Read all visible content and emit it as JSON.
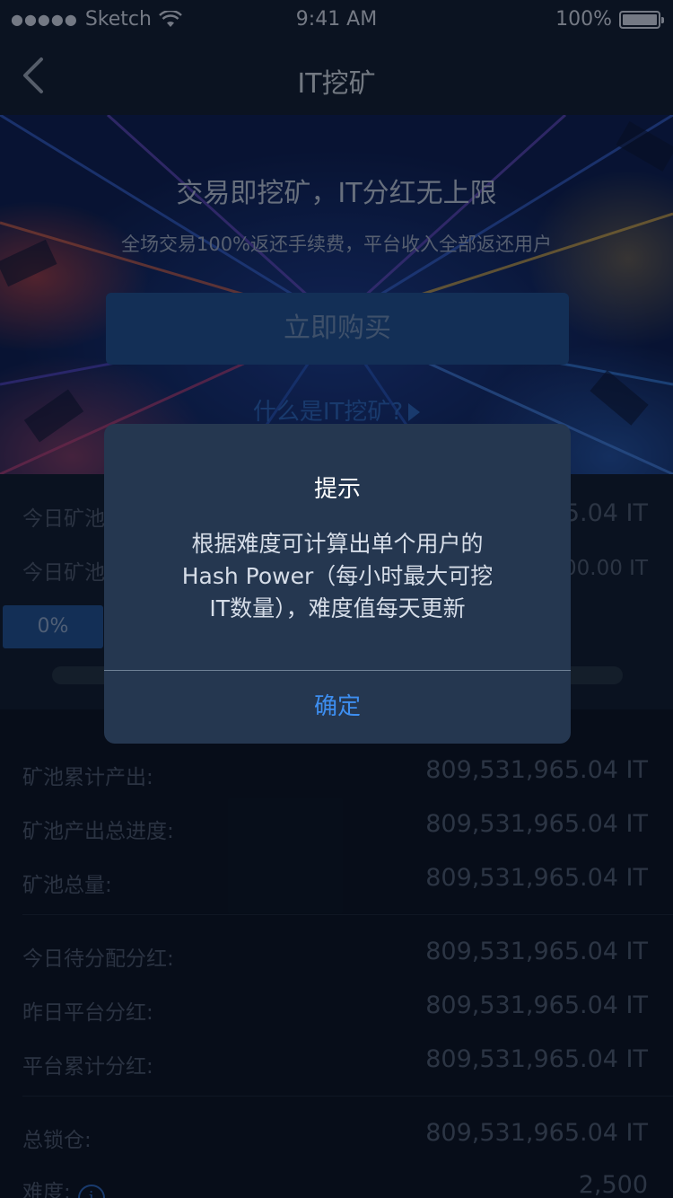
{
  "status_bar": {
    "carrier": "Sketch",
    "time": "9:41 AM",
    "battery": "100%"
  },
  "nav": {
    "title": "IT挖矿",
    "back_icon": "chevron-left-icon"
  },
  "hero": {
    "title": "交易即挖矿，IT分红无上限",
    "subtitle": "全场交易100%返还手续费，平台收入全部返还用户",
    "buy_label": "立即购买",
    "what_link": "什么是IT挖矿?"
  },
  "today": {
    "rows": [
      {
        "label": "今日矿池",
        "value": "5.04 IT"
      },
      {
        "label": "今日矿池",
        "value": "00.00 IT"
      }
    ],
    "progress_label": "0%",
    "progress_value": 0
  },
  "stats": {
    "groups": [
      [
        {
          "label": "矿池累计产出:",
          "value": "809,531,965.04 IT"
        },
        {
          "label": "矿池产出总进度:",
          "value": "809,531,965.04 IT"
        },
        {
          "label": "矿池总量:",
          "value": "809,531,965.04 IT"
        }
      ],
      [
        {
          "label": "今日待分配分红:",
          "value": "809,531,965.04 IT"
        },
        {
          "label": "昨日平台分红:",
          "value": "809,531,965.04 IT"
        },
        {
          "label": "平台累计分红:",
          "value": "809,531,965.04 IT"
        }
      ],
      [
        {
          "label": "总锁仓:",
          "value": "809,531,965.04 IT"
        },
        {
          "label": "难度:",
          "value": "2,500"
        }
      ]
    ]
  },
  "dialog": {
    "title": "提示",
    "message_line1": "根据难度可计算出单个用户的",
    "message_line2": "Hash Power（每小时最大可挖",
    "message_line3": "IT数量），难度值每天更新",
    "confirm_label": "确定"
  },
  "colors": {
    "accent": "#3d8ef0",
    "button_blue": "#1f4f8e",
    "background": "#0a1220"
  }
}
